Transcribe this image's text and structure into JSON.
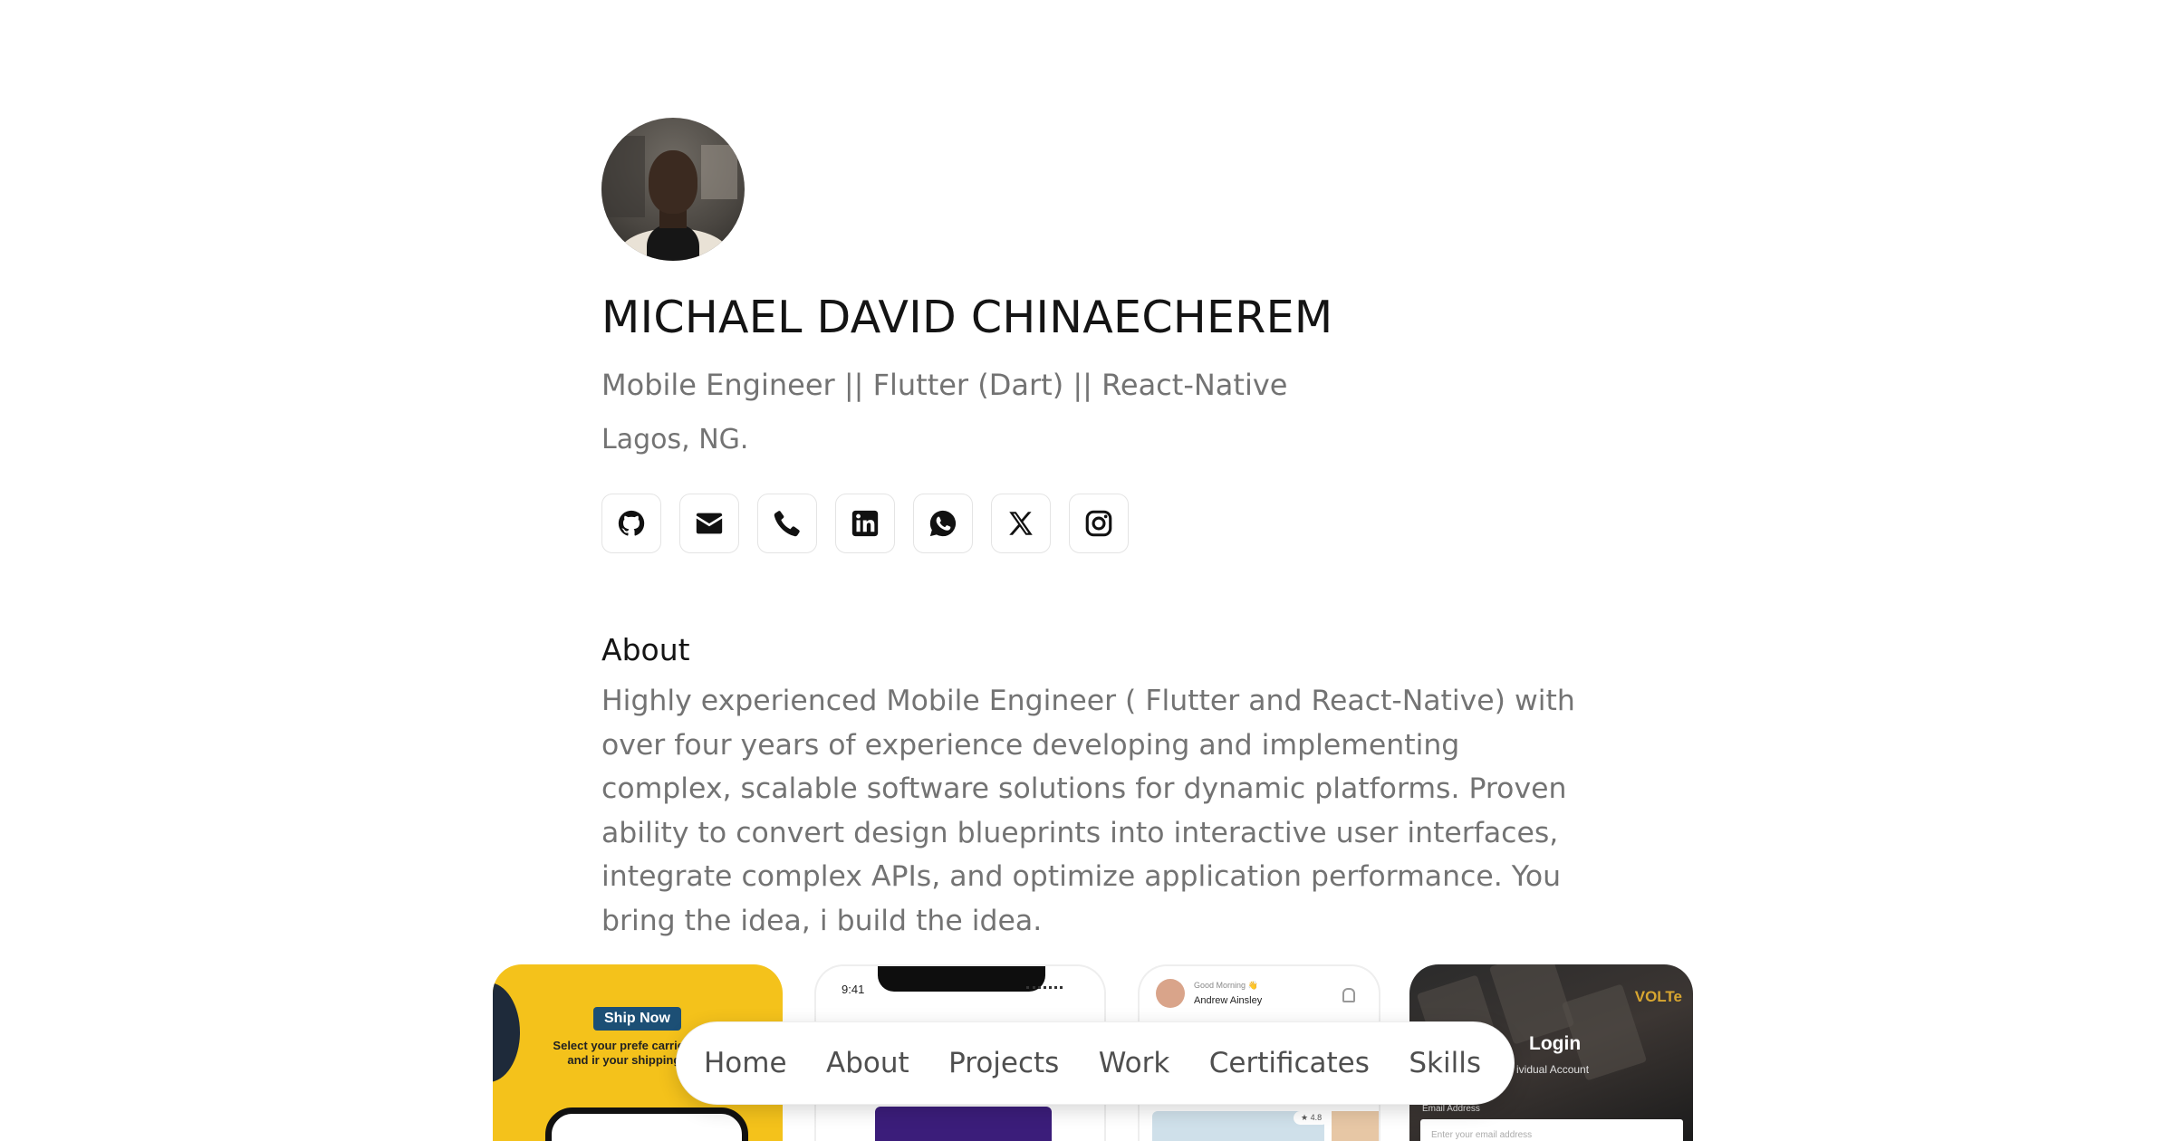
{
  "profile": {
    "name": "MICHAEL DAVID CHINAECHEREM",
    "headline": "Mobile Engineer || Flutter (Dart) || React-Native",
    "location": "Lagos, NG."
  },
  "socials": [
    {
      "icon": "github-icon"
    },
    {
      "icon": "mail-icon"
    },
    {
      "icon": "phone-icon"
    },
    {
      "icon": "linkedin-icon"
    },
    {
      "icon": "whatsapp-icon"
    },
    {
      "icon": "x-icon"
    },
    {
      "icon": "instagram-icon"
    }
  ],
  "about": {
    "title": "About",
    "text": "Highly experienced Mobile Engineer ( Flutter and React-Native) with over four years of experience developing and implementing complex, scalable software solutions for dynamic platforms. Proven ability to convert design blueprints into interactive user interfaces, integrate complex APIs, and optimize application performance. You bring the idea, i build the idea."
  },
  "showcase": {
    "shot1": {
      "badge": "Ship Now",
      "text": "Select your prefe carrier, book and ir your shipping effic"
    },
    "shot2": {
      "time": "9:41"
    },
    "shot3": {
      "greeting": "Good Morning 👋",
      "user": "Andrew Ainsley",
      "rating": "★ 4.8"
    },
    "shot4": {
      "brand": "VOLTe",
      "title": "Login",
      "subtitle": "ividual Account",
      "email_label": "Email Address",
      "email_placeholder": "Enter your email address"
    }
  },
  "nav": {
    "items": [
      "Home",
      "About",
      "Projects",
      "Work",
      "Certificates",
      "Skills"
    ]
  }
}
